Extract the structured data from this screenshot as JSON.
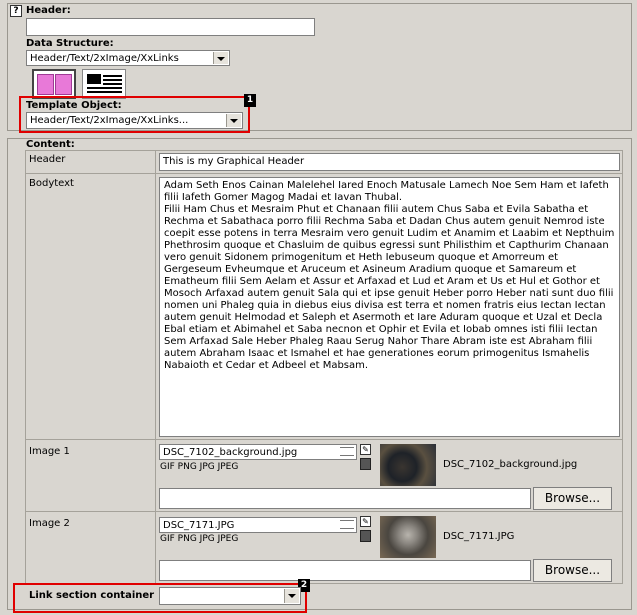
{
  "top": {
    "help_icon": "question-mark",
    "header_label": "Header:",
    "header_value": "",
    "ds_label": "Data Structure:",
    "ds_value": "Header/Text/2xImage/XxLinks",
    "to_label": "Template Object:",
    "to_value": "Header/Text/2xImage/XxLinks...",
    "callout1": "1"
  },
  "content": {
    "section_label": "Content:",
    "header_label": "Header",
    "header_value": "This is my Graphical Header",
    "bodytext_label": "Bodytext",
    "bodytext_value": "Adam Seth Enos Cainan Malelehel Iared Enoch Matusale Lamech Noe Sem Ham et Iafeth filii Iafeth Gomer Magog Madai et Iavan Thubal.\nFilii Ham Chus et Mesraim Phut et Chanaan filii autem Chus Saba et Evila Sabatha et Rechma et Sabathaca porro filii Rechma Saba et Dadan Chus autem genuit Nemrod iste coepit esse potens in terra Mesraim vero genuit Ludim et Anamim et Laabim et Nepthuim Phethrosim quoque et Chasluim de quibus egressi sunt Philisthim et Capthurim Chanaan vero genuit Sidonem primogenitum et Heth Iebuseum quoque et Amorreum et Gergeseum Evheumque et Aruceum et Asineum Aradium quoque et Samareum et Ematheum filii Sem Aelam et Assur et Arfaxad et Lud et Aram et Us et Hul et Gothor et Mosoch Arfaxad autem genuit Sala qui et ipse genuit Heber porro Heber nati sunt duo filii nomen uni Phaleg quia in diebus eius divisa est terra et nomen fratris eius Iectan Iectan autem genuit Helmodad et Saleph et Asermoth et Iare Aduram quoque et Uzal et Decla Ebal etiam et Abimahel et Saba necnon et Ophir et Evila et Iobab omnes isti filii Iectan Sem Arfaxad Sale Heber Phaleg Raau Serug Nahor Thare Abram iste est Abraham filii autem Abraham Isaac et Ismahel et hae generationes eorum primogenitus Ismahelis Nabaioth et Cedar et Adbeel et Mabsam.",
    "image1_label": "Image 1",
    "image1_file": "DSC_7102_background.jpg",
    "image1_types": "GIF PNG JPG JPEG",
    "image1_caption": "DSC_7102_background.jpg",
    "image2_label": "Image 2",
    "image2_file": "DSC_7171.JPG",
    "image2_types": "GIF PNG JPG JPEG",
    "image2_caption": "DSC_7171.JPG",
    "browse_label": "Browse...",
    "link_label": "Link section container",
    "link_value": "",
    "callout2": "2"
  },
  "colors": {
    "background": "#d9d6d0",
    "callout": "#e00000"
  }
}
